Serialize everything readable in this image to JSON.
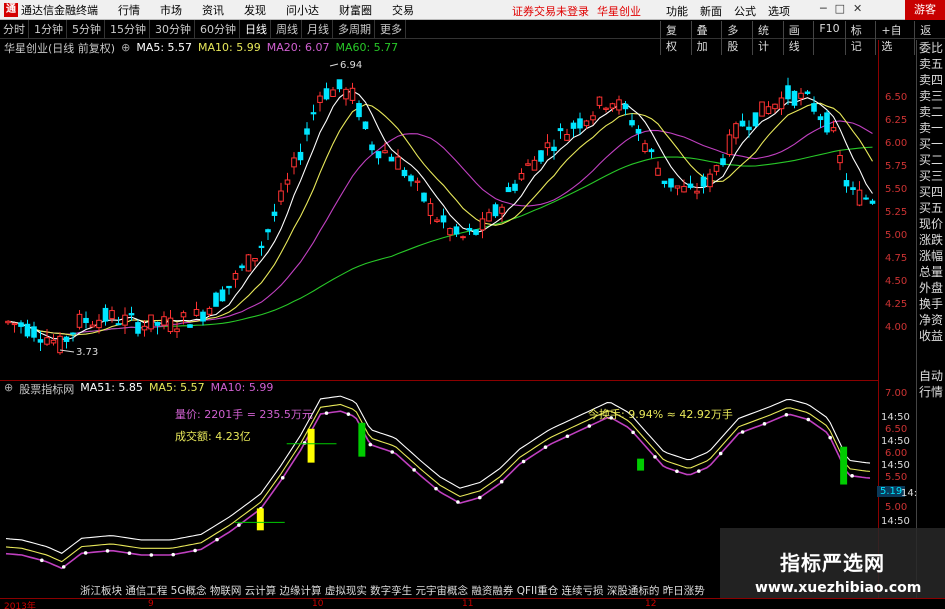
{
  "titlebar": {
    "app_title": "通达信金融终端",
    "menu": [
      "行情",
      "市场",
      "资讯",
      "发现",
      "问小达",
      "财富圈",
      "交易"
    ],
    "notice_links": [
      "证券交易未登录",
      "华星创业"
    ],
    "right_menu": [
      "功能",
      "新面",
      "公式",
      "选项"
    ],
    "guest_label": "游客"
  },
  "periods": [
    "分时",
    "1分钟",
    "5分钟",
    "15分钟",
    "30分钟",
    "60分钟",
    "日线",
    "周线",
    "月线",
    "多周期",
    "更多"
  ],
  "active_period": "日线",
  "toolbar": [
    "复权",
    "叠加",
    "多股",
    "统计",
    "画线",
    "F10",
    "标记",
    "+自选",
    "返回"
  ],
  "main_info": {
    "stock": "华星创业(日线 前复权)",
    "ma5": "MA5: 5.57",
    "ma10": "MA10: 5.99",
    "ma20": "MA20: 6.07",
    "ma60": "MA60: 5.77"
  },
  "indicator_info": {
    "name": "股票指标网",
    "ma51": "MA51: 5.85",
    "ma5": "MA5: 5.57",
    "ma10": "MA10: 5.99"
  },
  "annotations": {
    "high_label": "6.94",
    "low_label": "3.73",
    "volume_label": "量价: 2201手 = 235.5万元",
    "turnover_amount": "成交额: 4.23亿",
    "turnover_rate": "今换手: 9.94% ≈ 42.92万手"
  },
  "price_axis": [
    "6.50",
    "6.25",
    "6.00",
    "5.75",
    "5.50",
    "5.25",
    "5.00",
    "4.75",
    "4.50",
    "4.25",
    "4.00"
  ],
  "ind_axis": [
    "7.00",
    "6.50",
    "6.00",
    "5.50",
    "5.00"
  ],
  "ind_axis_times": [
    "14:50",
    "14:50",
    "14:50",
    "14:50",
    "14:50",
    "14:50",
    "14:50"
  ],
  "current_value": "5.19",
  "sidebar": [
    "委比",
    "卖五",
    "卖四",
    "卖三",
    "卖二",
    "卖一",
    "买一",
    "买二",
    "买三",
    "买四",
    "买五",
    "现价",
    "涨跌",
    "涨幅",
    "总量",
    "外盘",
    "换手",
    "净资",
    "收益",
    "",
    "自动",
    "行情"
  ],
  "date_axis": [
    "2013年",
    "9",
    "10",
    "11",
    "12"
  ],
  "concepts": "浙江板块 通信工程 5G概念 物联网 云计算 边缘计算 虚拟现实 数字孪生 元宇宙概念 融资融券 QFII重仓 连续亏损 深股通标的 昨日涨势",
  "watermark": {
    "title": "指标严选网",
    "url": "www.xuezhibiao.com"
  },
  "colors": {
    "up": "#ff3232",
    "down": "#00e5ff",
    "ma5": "#ffffff",
    "ma10": "#e8e85a",
    "ma20": "#c040c0",
    "ma60": "#28c828"
  }
}
